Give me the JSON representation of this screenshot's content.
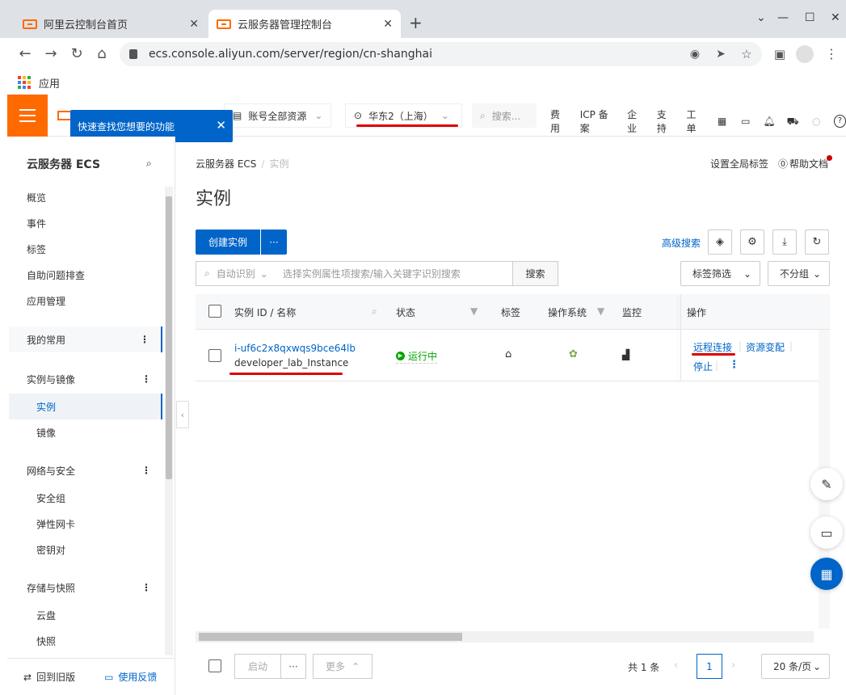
{
  "browser": {
    "tabs": [
      {
        "title": "阿里云控制台首页"
      },
      {
        "title": "云服务器管理控制台"
      }
    ],
    "url": "ecs.console.aliyun.com/server/region/cn-shanghai",
    "bookmark": "应用"
  },
  "topbar": {
    "resources": "账号全部资源",
    "region": "华东2（上海）",
    "search_placeholder": "搜索...",
    "nav": [
      "费用",
      "ICP 备案",
      "企业",
      "支持",
      "工单"
    ]
  },
  "tooltip": "快速查找您想要的功能",
  "sidebar": {
    "title": "云服务器 ECS",
    "items": [
      "概览",
      "事件",
      "标签",
      "自助问题排查",
      "应用管理"
    ],
    "group_favorites": "我的常用",
    "group_instances": "实例与镜像",
    "instances_sub": [
      "实例",
      "镜像"
    ],
    "group_network": "网络与安全",
    "network_sub": [
      "安全组",
      "弹性网卡",
      "密钥对"
    ],
    "group_storage": "存储与快照",
    "storage_sub": [
      "云盘",
      "快照"
    ],
    "footer_old": "回到旧版",
    "footer_feedback": "使用反馈"
  },
  "main": {
    "breadcrumb": [
      "云服务器 ECS",
      "实例"
    ],
    "global_tag": "设置全局标签",
    "help_doc": "帮助文档",
    "title": "实例",
    "create_btn": "创建实例",
    "more_btn": "···",
    "adv_search": "高级搜索",
    "search_mode": "自动识别",
    "search_placeholder": "选择实例属性项搜索/输入关键字识别搜索",
    "search_btn": "搜索",
    "tag_filter": "标签筛选",
    "group_by": "不分组",
    "columns": [
      "实例 ID / 名称",
      "状态",
      "标签",
      "操作系统",
      "监控",
      "操作"
    ],
    "row": {
      "id": "i-uf6c2x8qxwqs9bce64lb",
      "name": "developer_lab_Instance",
      "status": "运行中",
      "actions": [
        "远程连接",
        "资源变配",
        "停止"
      ]
    },
    "footer": {
      "start": "启动",
      "more": "更多",
      "total": "共 1 条",
      "page": "1",
      "page_size": "20 条/页"
    }
  }
}
